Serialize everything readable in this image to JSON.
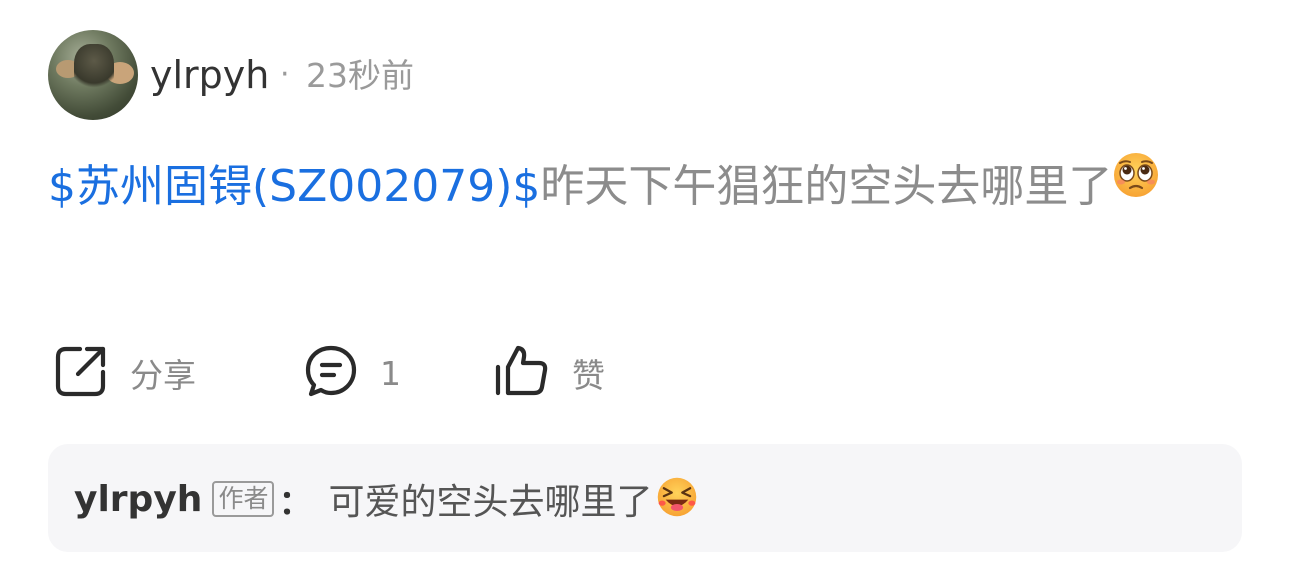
{
  "post": {
    "username": "ylrpyh",
    "dot": "·",
    "timestamp": "23秒前",
    "stock_link": "$苏州固锝(SZ002079)$",
    "text": "昨天下午猖狂的空头去哪里了",
    "emoji": "pleading-face"
  },
  "actions": {
    "share_label": "分享",
    "comment_count": "1",
    "like_label": "赞"
  },
  "reply": {
    "username": "ylrpyh",
    "badge": "作者",
    "colon": "：",
    "text": "可爱的空头去哪里了",
    "emoji": "squinting-face-with-tongue"
  },
  "colors": {
    "link": "#1a6fe0",
    "muted_text": "#8c8c8c",
    "reply_bg": "#f6f6f8"
  }
}
